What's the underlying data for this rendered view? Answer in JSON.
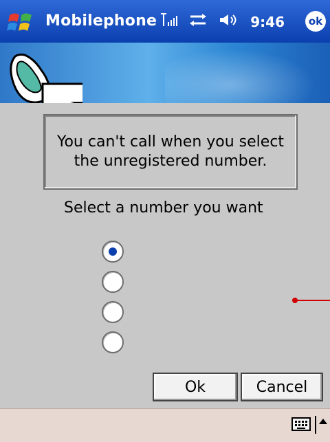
{
  "app": {
    "title": "Mobilephone",
    "time": "9:46",
    "ok_label": "ok"
  },
  "dialog": {
    "message": "You can't call when you select\nthe unregistered number.",
    "prompt": "Select a number you want",
    "radio_count": 4,
    "selected_index": 0
  },
  "buttons": {
    "ok": "Ok",
    "cancel": "Cancel"
  },
  "colors": {
    "titlebar_blue": "#0b3fae",
    "background_gray": "#c8c8c8",
    "bottom_bar": "#e7d9d2",
    "annotation_red": "#d00000"
  },
  "icons": [
    "windows-start-icon",
    "signal-icon",
    "sync-icon",
    "volume-icon",
    "keyboard-icon",
    "up-arrow-icon"
  ]
}
